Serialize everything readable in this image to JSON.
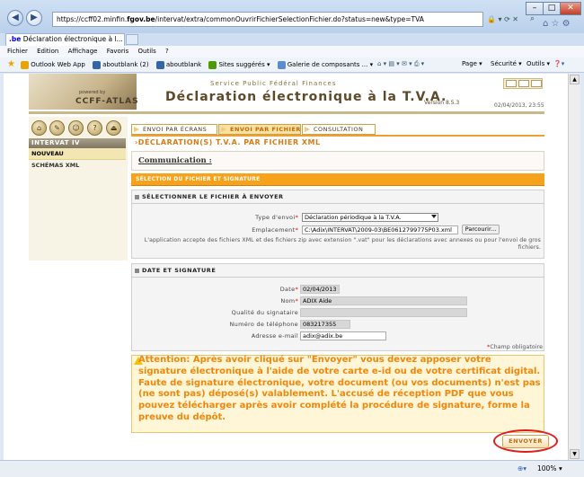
{
  "browser": {
    "address": "https://ccff02.minfin.fgov.be/intervat/extra/commonOuvrirFichierSelectionFichier.do?status=new&type=TVA",
    "address_prefix": "https://ccff02.minfin.",
    "address_bold": "fgov.be",
    "address_rest": "/intervat/extra/commonOuvrirFichierSelectionFichier.do?status=new&type=TVA",
    "tab_title": "Déclaration électronique à l...",
    "menu": [
      "Fichier",
      "Edition",
      "Affichage",
      "Favoris",
      "Outils",
      "?"
    ],
    "favorites": [
      "Outlook Web App",
      "aboutblank (2)",
      "aboutblank",
      "Sites suggérés ▾",
      "Galerie de composants ... ▾"
    ],
    "tools": [
      "Page ▾",
      "Sécurité ▾",
      "Outils ▾"
    ],
    "zoom": "100%",
    "colors": {
      "chrome": "#cfe0f3",
      "accent": "#f7a21b",
      "warning_text": "#f0870a"
    }
  },
  "header": {
    "logo_text": "CCFF-ATLAS",
    "logo_powered": "powered by",
    "service": "Service Public Fédéral Finances",
    "title": "Déclaration électronique à la T.V.A.",
    "version": "Version 8.5.3",
    "datetime": "02/04/2013, 23:55"
  },
  "sidebar": {
    "icons": [
      "home-icon",
      "tools-icon",
      "user-icon",
      "help-icon",
      "exit-icon"
    ],
    "section": "INTERVAT IV",
    "items": [
      {
        "label": "NOUVEAU",
        "active": true
      },
      {
        "label": "SCHÉMAS XML",
        "active": false
      }
    ]
  },
  "tabs": [
    {
      "label": "ENVOI PAR ÉCRANS",
      "active": false
    },
    {
      "label": "ENVOI PAR FICHIER",
      "active": true
    },
    {
      "label": "CONSULTATION",
      "active": false
    }
  ],
  "main": {
    "page_title": "DÉCLARATION(S) T.V.A. PAR FICHIER XML",
    "communication_label": "Communication :",
    "band_label": "SÉLECTION DU FICHIER ET SIGNATURE",
    "file_section": {
      "title": "SÉLECTIONNER LE FICHIER À ENVOYER",
      "type_label": "Type d'envoi",
      "type_value": "Déclaration périodique à la T.V.A.",
      "location_label": "Emplacement",
      "location_value": "C:\\Adix\\INTERVAT\\2009-03\\BE0612799775P03.xml",
      "browse_label": "Parcourir...",
      "help_text": "L'application accepte des fichiers XML et des fichiers zip avec extension \".vat\" pour les déclarations avec annexes ou pour l'envoi de gros fichiers."
    },
    "signature_section": {
      "title": "DATE ET SIGNATURE",
      "date_label": "Date",
      "date_value": "02/04/2013",
      "name_label": "Nom",
      "name_value": "ADIX Aide",
      "quality_label": "Qualité du signataire",
      "quality_value": "",
      "phone_label": "Numéro de téléphone",
      "phone_value": "083217355",
      "email_label": "Adresse e-mail",
      "email_value": "adix@adix.be",
      "required_note": "Champ obligatoire"
    },
    "warning": "Attention: Après avoir cliqué sur \"Envoyer\" vous devez apposer votre signature électronique à l'aide de votre carte e-id ou de votre certificat digital. Faute de signature électronique, votre document (ou vos documents) n'est pas (ne sont pas) déposé(s) valablement. L'accusé de réception PDF que vous pouvez télécharger après avoir complété la procédure de signature, forme la preuve du dépôt.",
    "submit_label": "ENVOYER"
  }
}
